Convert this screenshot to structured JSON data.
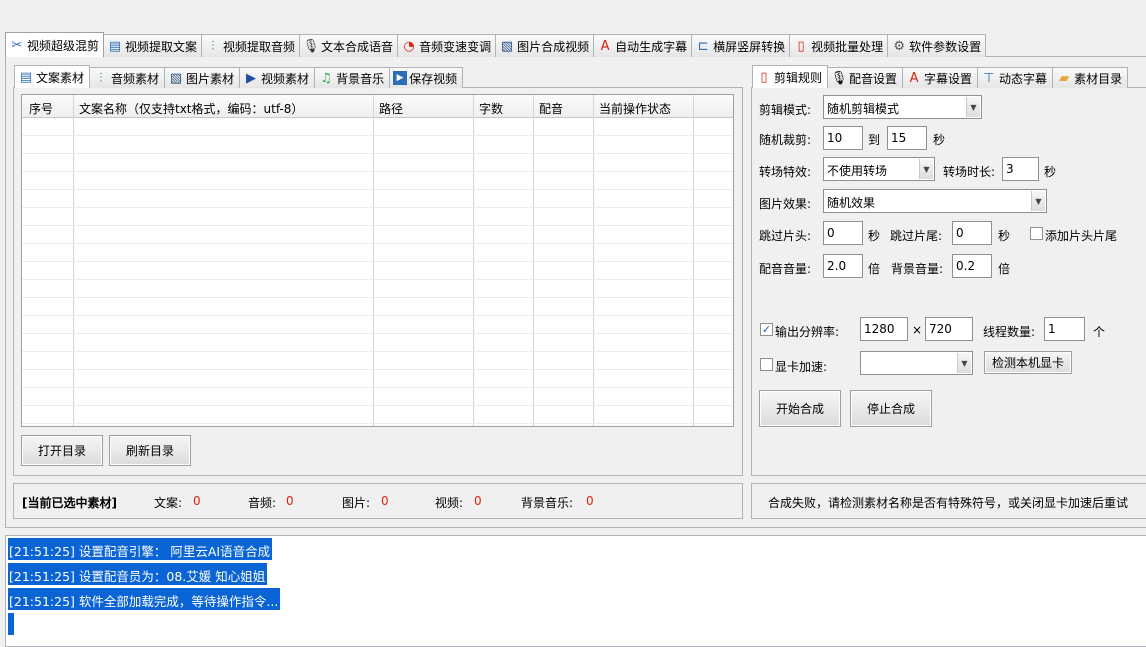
{
  "main_tabs": [
    {
      "label": "视频超级混剪",
      "icon": "scissors-icon",
      "active": true
    },
    {
      "label": "视频提取文案",
      "icon": "document-icon"
    },
    {
      "label": "视频提取音频",
      "icon": "audio-wave-icon"
    },
    {
      "label": "文本合成语音",
      "icon": "microphone-icon"
    },
    {
      "label": "音频变速变调",
      "icon": "gauge-icon"
    },
    {
      "label": "图片合成视频",
      "icon": "image-icon"
    },
    {
      "label": "自动生成字幕",
      "icon": "font-icon"
    },
    {
      "label": "横屏竖屏转换",
      "icon": "rotate-screen-icon"
    },
    {
      "label": "视频批量处理",
      "icon": "film-icon"
    },
    {
      "label": "软件参数设置",
      "icon": "gear-icon"
    }
  ],
  "left_tabs": [
    {
      "label": "文案素材",
      "icon": "document-icon",
      "active": true
    },
    {
      "label": "音频素材",
      "icon": "audio-wave-icon"
    },
    {
      "label": "图片素材",
      "icon": "image-icon"
    },
    {
      "label": "视频素材",
      "icon": "play-icon"
    },
    {
      "label": "背景音乐",
      "icon": "music-note-icon"
    },
    {
      "label": "保存视频",
      "icon": "save-icon"
    }
  ],
  "table": {
    "columns": [
      "序号",
      "文案名称（仅支持txt格式，编码：utf-8）",
      "路径",
      "字数",
      "配音",
      "当前操作状态"
    ]
  },
  "left_buttons": {
    "open_dir": "打开目录",
    "refresh_dir": "刷新目录"
  },
  "right_tabs": [
    {
      "label": "剪辑规则",
      "icon": "film-icon",
      "active": true
    },
    {
      "label": "配音设置",
      "icon": "microphone-icon"
    },
    {
      "label": "字幕设置",
      "icon": "font-icon"
    },
    {
      "label": "动态字幕",
      "icon": "text-box-icon"
    },
    {
      "label": "素材目录",
      "icon": "folder-icon"
    }
  ],
  "settings": {
    "edit_mode_label": "剪辑模式:",
    "edit_mode_value": "随机剪辑模式",
    "random_cut_label": "随机裁剪:",
    "random_cut_from": "10",
    "to_label": "到",
    "random_cut_to": "15",
    "sec": "秒",
    "transition_label": "转场特效:",
    "transition_value": "不使用转场",
    "transition_dur_label": "转场时长:",
    "transition_dur": "3",
    "image_effect_label": "图片效果:",
    "image_effect_value": "随机效果",
    "skip_head_label": "跳过片头:",
    "skip_head": "0",
    "skip_tail_label": "跳过片尾:",
    "skip_tail": "0",
    "add_head_tail_label": "添加片头片尾",
    "add_head_tail_checked": false,
    "dub_volume_label": "配音音量:",
    "dub_volume": "2.0",
    "times": "倍",
    "bg_volume_label": "背景音量:",
    "bg_volume": "0.2",
    "output_res_label": "输出分辨率:",
    "output_res_checked": true,
    "res_width": "1280",
    "res_x": "×",
    "res_height": "720",
    "threads_label": "线程数量:",
    "threads": "1",
    "threads_unit": "个",
    "gpu_label": "显卡加速:",
    "gpu_checked": false,
    "gpu_value": "",
    "detect_gpu_button": "检测本机显卡",
    "start_button": "开始合成",
    "stop_button": "停止合成"
  },
  "status": {
    "title": "[当前已选中素材]",
    "text_label": "文案:",
    "text_count": "0",
    "audio_label": "音频:",
    "audio_count": "0",
    "image_label": "图片:",
    "image_count": "0",
    "video_label": "视频:",
    "video_count": "0",
    "bgm_label": "背景音乐:",
    "bgm_count": "0",
    "message": "合成失败，请检测素材名称是否有特殊符号，或关闭显卡加速后重试"
  },
  "log": [
    "[21:51:25] 设置配音引擎： 阿里云AI语音合成",
    "[21:51:25] 设置配音员为：08.艾媛 知心姐姐",
    "[21:51:25] 软件全部加载完成，等待操作指令..."
  ],
  "colors": {
    "accent": "#0a64d6",
    "count": "#d9230f"
  }
}
